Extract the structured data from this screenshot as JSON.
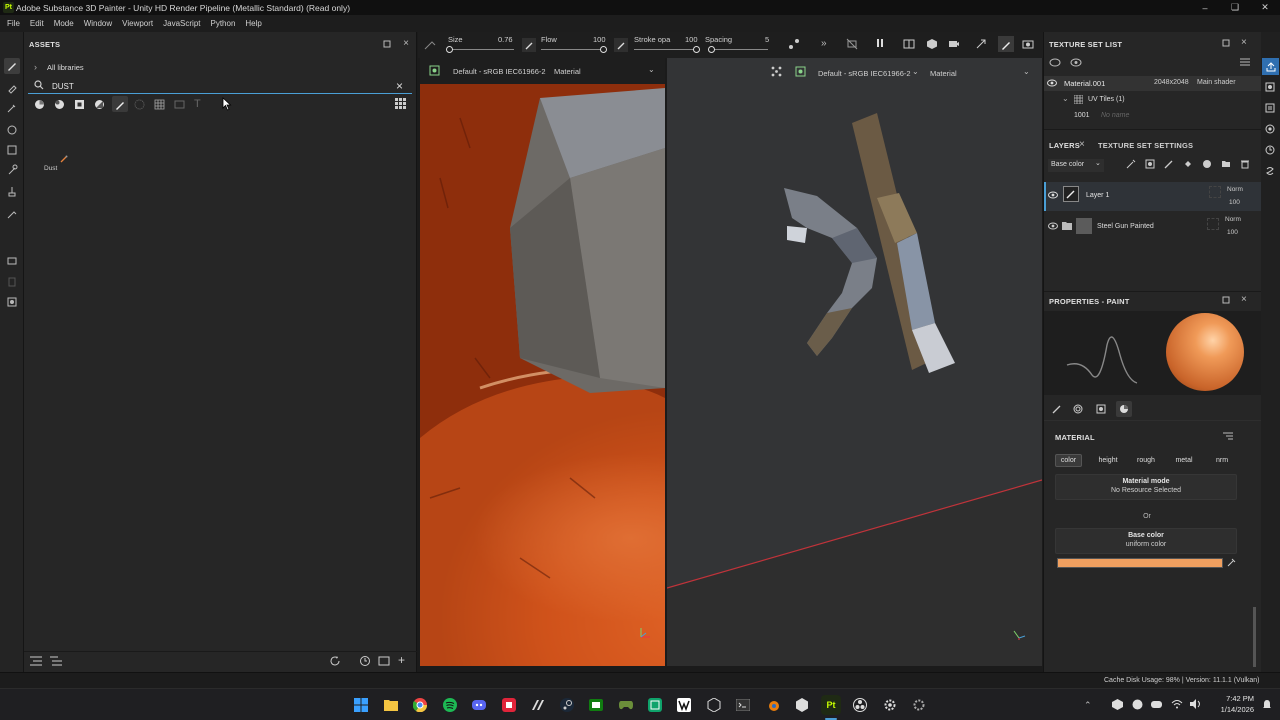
{
  "app": {
    "logo_text": "Pt",
    "title": "Adobe Substance 3D Painter - Unity HD Render Pipeline (Metallic Standard) (Read only)"
  },
  "menu": [
    "File",
    "Edit",
    "Mode",
    "Window",
    "Viewport",
    "JavaScript",
    "Python",
    "Help"
  ],
  "assets": {
    "title": "ASSETS",
    "breadcrumb": "All libraries",
    "search_value": "DUST",
    "results": [
      {
        "label": "Dust"
      }
    ]
  },
  "toolbar": {
    "size_label": "Size",
    "size_value": "0.76",
    "flow_label": "Flow",
    "flow_value": "100",
    "stroke_label": "Stroke opa",
    "stroke_value": "100",
    "spacing_label": "Spacing",
    "spacing_value": "5",
    "size_fraction": 0.02,
    "flow_fraction": 1.0,
    "stroke_fraction": 1.0,
    "spacing_fraction": 0.05
  },
  "viewport2d": {
    "colorspace": "Default - sRGB IEC61966-2",
    "channel": "Material"
  },
  "viewport3d": {
    "colorspace": "Default - sRGB IEC61966-2",
    "channel": "Material"
  },
  "texture_set_list": {
    "title": "TEXTURE SET LIST",
    "material": "Material.001",
    "resolution": "2048x2048",
    "shader": "Main shader",
    "uv_tiles_label": "UV Tiles (1)",
    "tile": "1001",
    "tile_name": "No name"
  },
  "layers": {
    "tab_layers": "LAYERS",
    "tab_settings": "TEXTURE SET SETTINGS",
    "channel": "Base color",
    "items": [
      {
        "name": "Layer 1",
        "blend": "Norm",
        "opacity": "100"
      },
      {
        "name": "Steel Gun Painted",
        "blend": "Norm",
        "opacity": "100"
      }
    ]
  },
  "properties": {
    "title": "PROPERTIES - PAINT",
    "section": "MATERIAL",
    "channels": [
      "color",
      "height",
      "rough",
      "metal",
      "nrm"
    ],
    "material_mode_label": "Material mode",
    "material_mode_value": "No Resource Selected",
    "or_label": "Or",
    "base_color_label": "Base color",
    "base_color_sub": "uniform color",
    "base_color_hex": "#f0a060"
  },
  "status": {
    "text": "Cache Disk Usage: 98% | Version: 11.1.1 (Vulkan)"
  },
  "taskbar": {
    "time": "7:42 PM",
    "date": "1/14/2026"
  },
  "colors": {
    "accent": "#4a9fd6",
    "orange": "#e8823c"
  }
}
